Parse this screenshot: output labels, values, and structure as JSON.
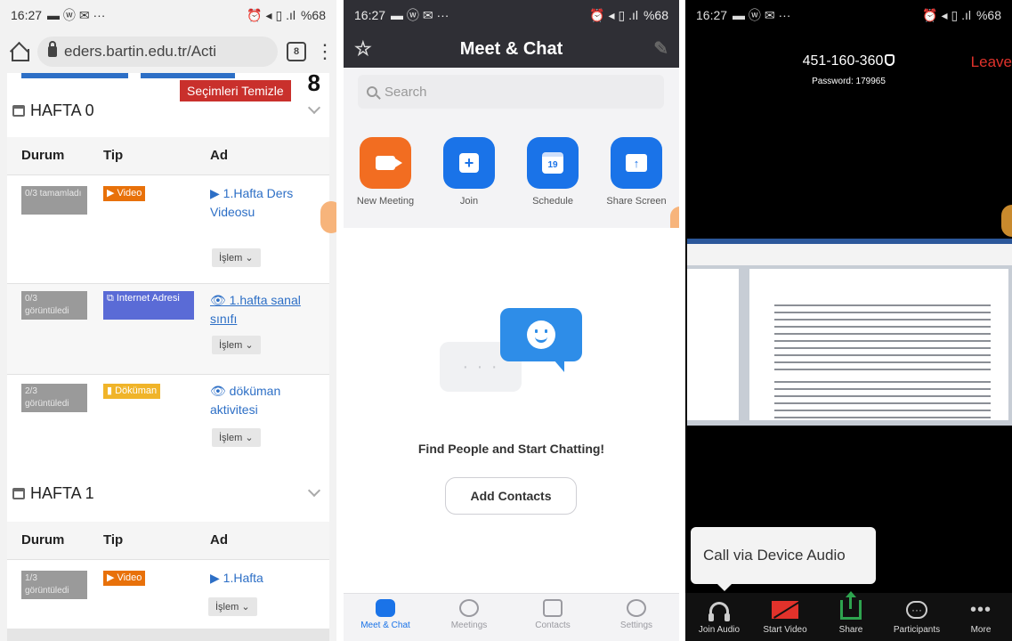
{
  "status_bar": {
    "time": "16:27",
    "left_icons": "▬ ⓦ ✉ ···",
    "right_icons": "⏰ ◂ ▯ .ıl",
    "battery": "%68"
  },
  "browser": {
    "url": "eders.bartin.edu.tr/Acti",
    "tabs_count": "8",
    "clear_label": "Seçimleri Temizle",
    "counter": "8",
    "weeks": [
      {
        "title": "HAFTA 0",
        "headers": [
          "Durum",
          "Tip",
          "Ad"
        ],
        "rows": [
          {
            "status": "0/3 tamamladı",
            "type": "Video",
            "type_color": "#e8710a",
            "name": "▶ 1.Hafta Ders Videosu",
            "action": "İşlem ⌄"
          },
          {
            "status": "0/3 görüntüledi",
            "type": "Internet Adresi",
            "type_color": "#5a6bd6",
            "name": "👁 1.hafta sanal sınıfı",
            "action": "İşlem ⌄"
          },
          {
            "status": "2/3 görüntüledi",
            "type": "Döküman",
            "type_color": "#f0b429",
            "name": "👁 döküman aktivitesi",
            "action": "İşlem ⌄"
          }
        ]
      },
      {
        "title": "HAFTA 1",
        "headers": [
          "Durum",
          "Tip",
          "Ad"
        ],
        "rows": [
          {
            "status": "1/3 görüntüledi",
            "type": "Video",
            "type_color": "#e8710a",
            "name": "▶ 1.Hafta",
            "action": "İşlem ⌄"
          }
        ]
      }
    ]
  },
  "meet_chat": {
    "title": "Meet & Chat",
    "search_placeholder": "Search",
    "actions": [
      {
        "label": "New Meeting",
        "icon": "video-camera-icon",
        "color": "#f26d21"
      },
      {
        "label": "Join",
        "icon": "plus-icon",
        "color": "#1a73e8"
      },
      {
        "label": "Schedule",
        "icon": "calendar-icon",
        "color": "#1a73e8",
        "glyph": "19"
      },
      {
        "label": "Share Screen",
        "icon": "share-screen-icon",
        "color": "#1a73e8"
      }
    ],
    "bubble_text": "· · ·",
    "empty_title": "Find People and Start Chatting!",
    "add_contacts": "Add Contacts",
    "tabs": [
      "Meet & Chat",
      "Meetings",
      "Contacts",
      "Settings"
    ]
  },
  "meeting": {
    "id": "451-160-360",
    "password": "Password: 179965",
    "leave": "Leave",
    "audio_popup": "Call via Device Audio",
    "controls": [
      "Join Audio",
      "Start Video",
      "Share",
      "Participants",
      "More"
    ]
  }
}
